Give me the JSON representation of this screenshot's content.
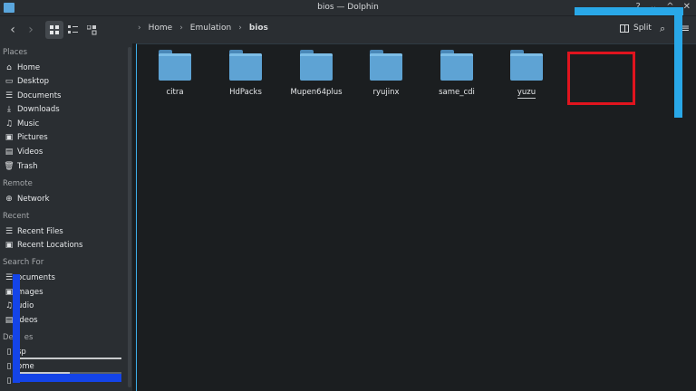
{
  "window": {
    "title": "bios — Dolphin",
    "controls": [
      "?",
      "⌄",
      "^",
      "✕"
    ]
  },
  "toolbar": {
    "back": "‹",
    "forward": "›",
    "breadcrumb": [
      "Home",
      "Emulation",
      "bios"
    ],
    "split_label": "Split",
    "search": "🔍",
    "menu": "≡"
  },
  "sidebar": {
    "places_heading": "Places",
    "places": [
      "Home",
      "Desktop",
      "Documents",
      "Downloads",
      "Music",
      "Pictures",
      "Videos",
      "Trash"
    ],
    "remote_heading": "Remote",
    "remote": [
      "Network"
    ],
    "recent_heading": "Recent",
    "recent": [
      "Recent Files",
      "Recent Locations"
    ],
    "search_heading": "Search For",
    "search_for": [
      "ocuments",
      "mages",
      "udio",
      "ideos"
    ],
    "devices_heading": "De",
    "devices_heading_tail": "es",
    "devices": [
      "sp",
      "ome"
    ],
    "device_home_usage": 0.5
  },
  "files": [
    "citra",
    "HdPacks",
    "Mupen64plus",
    "ryujinx",
    "same_cdi",
    "yuzu"
  ],
  "colors": {
    "accent": "#3daee9",
    "folder": "#5ea3d4",
    "highlight_red": "#e0141e",
    "highlight_cyan": "#29a8e8",
    "highlight_blue": "#1444e8"
  }
}
